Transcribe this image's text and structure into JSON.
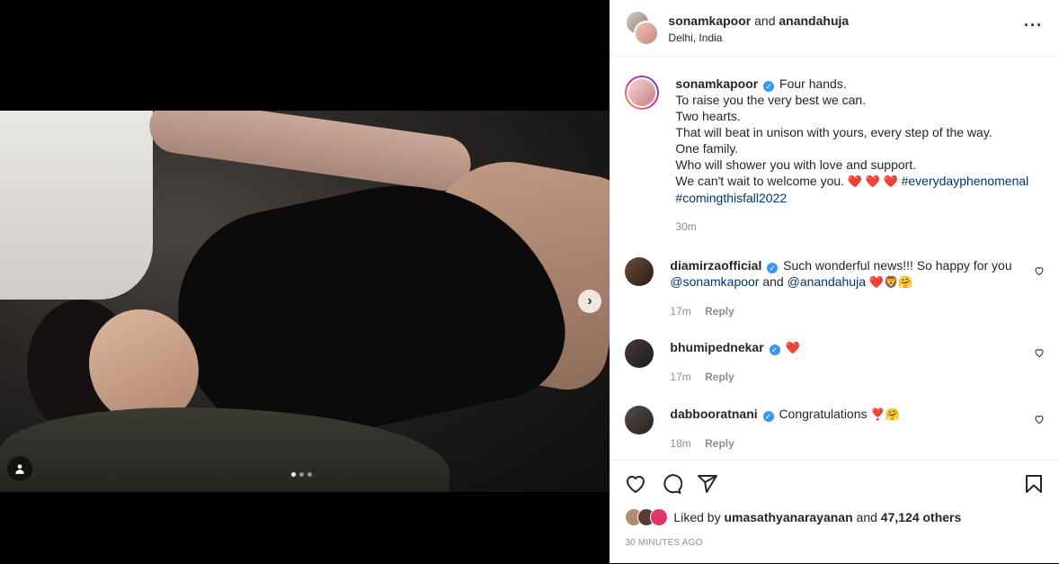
{
  "header": {
    "user1": "sonamkapoor",
    "conjunction": "and",
    "user2": "anandahuja",
    "location": "Delhi, India"
  },
  "caption": {
    "username": "sonamkapoor",
    "lines": [
      "Four hands.",
      "To raise you the very best we can.",
      "Two hearts.",
      "That will beat in unison with yours, every step of the way.",
      "One family.",
      "Who will shower you with love and support."
    ],
    "last_line": "We can't wait to welcome you.",
    "hashtag1": "#everydayphenomenal",
    "hashtag2": "#comingthisfall2022",
    "time": "30m"
  },
  "comments": [
    {
      "username": "diamirzaofficial",
      "text": "Such wonderful news!!! So happy for you",
      "mention1": "@sonamkapoor",
      "mid": "and",
      "mention2": "@anandahuja",
      "time": "17m",
      "reply": "Reply"
    },
    {
      "username": "bhumipednekar",
      "text": "",
      "time": "17m",
      "reply": "Reply"
    },
    {
      "username": "dabbooratnani",
      "text": "Congratulations",
      "time": "18m",
      "reply": "Reply"
    }
  ],
  "likes": {
    "prefix": "Liked by",
    "user": "umasathyanarayanan",
    "middle": "and",
    "count": "47,124 others"
  },
  "timestamp": "30 MINUTES AGO",
  "carousel": {
    "current": 1,
    "total": 3
  },
  "colors": {
    "verified": "#3897f0",
    "link": "#00376b",
    "heart": "#ed4956"
  },
  "icons": [
    "more-options-icon",
    "like-icon",
    "comment-icon",
    "share-icon",
    "save-icon",
    "next-arrow-icon",
    "user-tag-icon",
    "verified-badge-icon"
  ]
}
